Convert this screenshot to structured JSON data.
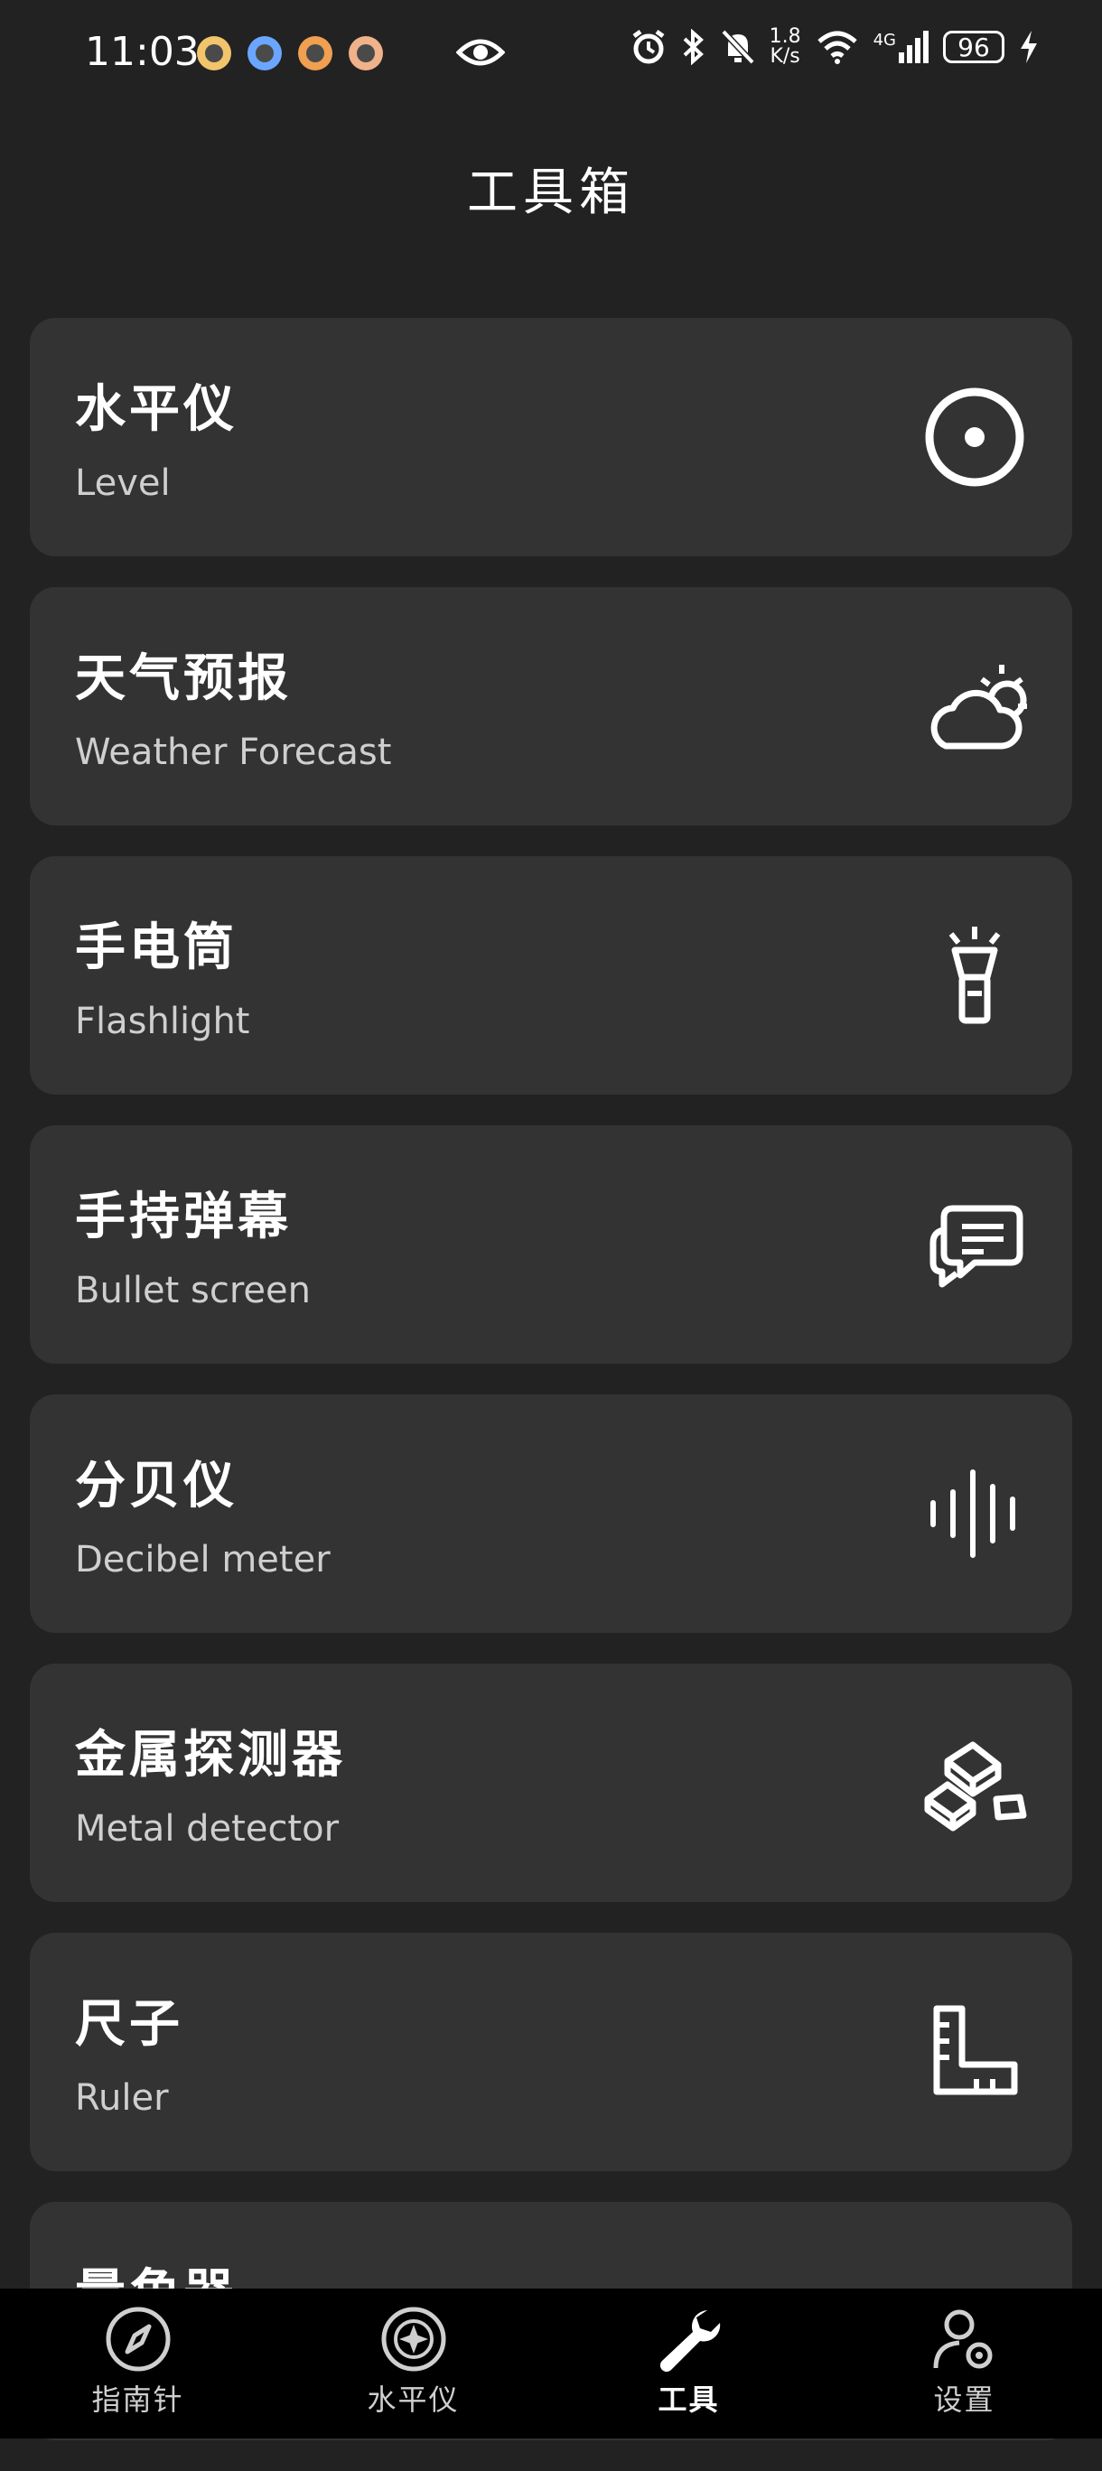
{
  "status_bar": {
    "time": "11:03",
    "net_speed_value": "1.8",
    "net_speed_unit": "K/s",
    "signal_label": "4G",
    "battery_level": "96"
  },
  "header": {
    "title": "工具箱"
  },
  "tools": [
    {
      "title": "水平仪",
      "subtitle": "Level",
      "icon": "level-target-icon"
    },
    {
      "title": "天气预报",
      "subtitle": "Weather Forecast",
      "icon": "weather-cloud-sun-icon"
    },
    {
      "title": "手电筒",
      "subtitle": "Flashlight",
      "icon": "flashlight-icon"
    },
    {
      "title": "手持弹幕",
      "subtitle": "Bullet screen",
      "icon": "chat-bubble-icon"
    },
    {
      "title": "分贝仪",
      "subtitle": "Decibel meter",
      "icon": "sound-wave-icon"
    },
    {
      "title": "金属探测器",
      "subtitle": "Metal detector",
      "icon": "gold-bars-icon"
    },
    {
      "title": "尺子",
      "subtitle": "Ruler",
      "icon": "ruler-icon"
    },
    {
      "title": "量角器",
      "subtitle": "",
      "icon": "protractor-icon"
    }
  ],
  "bottom_nav": [
    {
      "label": "指南针",
      "icon": "compass-icon"
    },
    {
      "label": "水平仪",
      "icon": "level-icon"
    },
    {
      "label": "工具",
      "icon": "wrench-icon",
      "active": true
    },
    {
      "label": "设置",
      "icon": "settings-user-icon"
    }
  ]
}
